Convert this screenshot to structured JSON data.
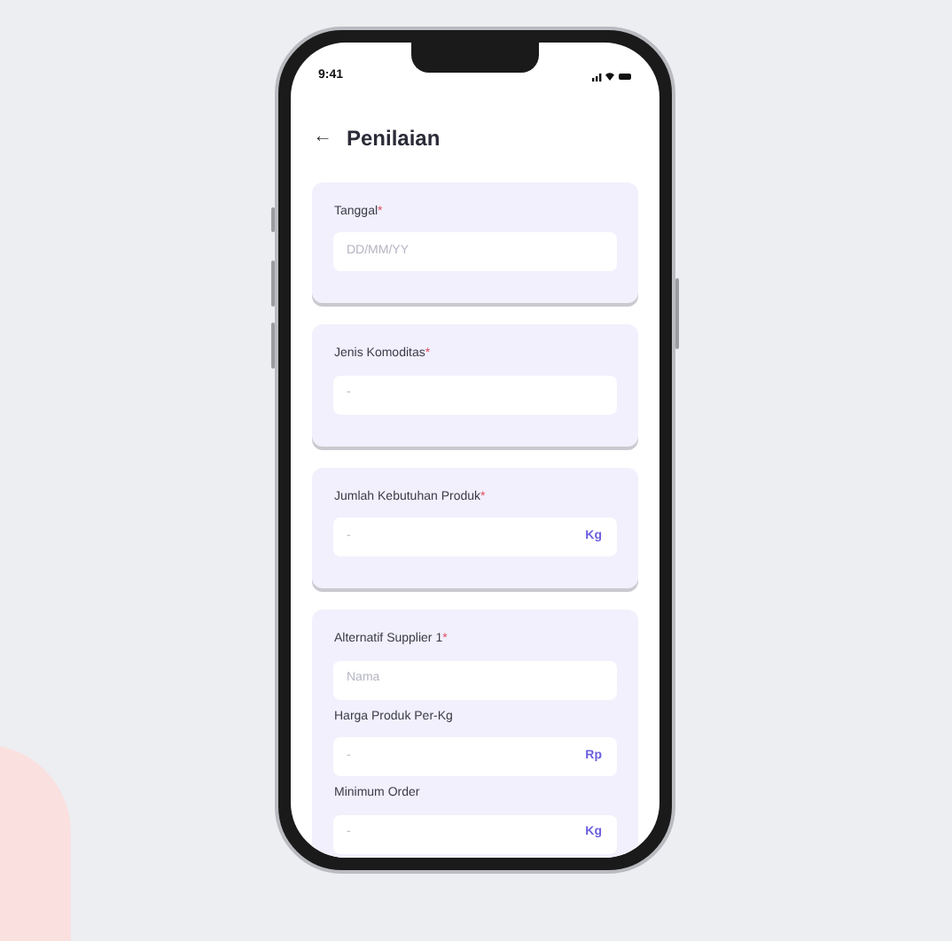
{
  "status_bar": {
    "time": "9:41"
  },
  "header": {
    "back_icon": "←",
    "title": "Penilaian"
  },
  "cards": [
    {
      "title": "Tanggal",
      "mark": "*",
      "fields": [
        {
          "placeholder": "DD/MM/YY"
        }
      ]
    },
    {
      "title": "Jenis Komoditas",
      "mark": "*",
      "fields": [
        {
          "placeholder": "-"
        }
      ]
    },
    {
      "title": "Jumlah Kebutuhan Produk",
      "mark": "*",
      "fields": [
        {
          "placeholder": "-",
          "unit": "Kg"
        }
      ]
    },
    {
      "title": "Alternatif Supplier 1",
      "mark": "*",
      "fields": [
        {
          "placeholder": "Nama"
        },
        {
          "label": "Harga Produk Per-Kg",
          "placeholder": "-",
          "unit": "Rp"
        },
        {
          "label": "Minimum Order",
          "placeholder": "-",
          "unit": "Kg"
        }
      ]
    }
  ]
}
